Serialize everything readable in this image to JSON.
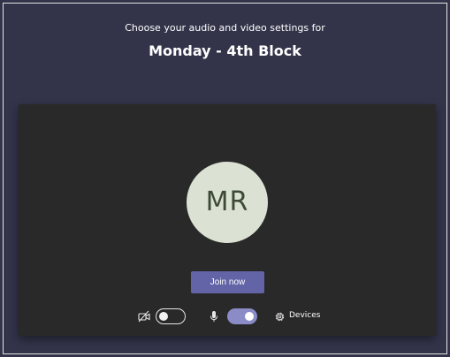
{
  "prejoin": {
    "subtitle": "Choose your audio and video settings for",
    "meeting_title": "Monday - 4th Block"
  },
  "preview": {
    "avatar_initials": "MR",
    "join_button_label": "Join now"
  },
  "controls": {
    "camera": {
      "icon": "video-off-icon",
      "enabled": false
    },
    "microphone": {
      "icon": "microphone-icon",
      "enabled": true
    },
    "devices": {
      "icon": "gear-icon",
      "label": "Devices"
    }
  },
  "colors": {
    "background": "#33344a",
    "preview": "#292929",
    "accent": "#6264a7",
    "toggle_on": "#8b8cc7",
    "avatar_bg": "#dbe2d3"
  }
}
